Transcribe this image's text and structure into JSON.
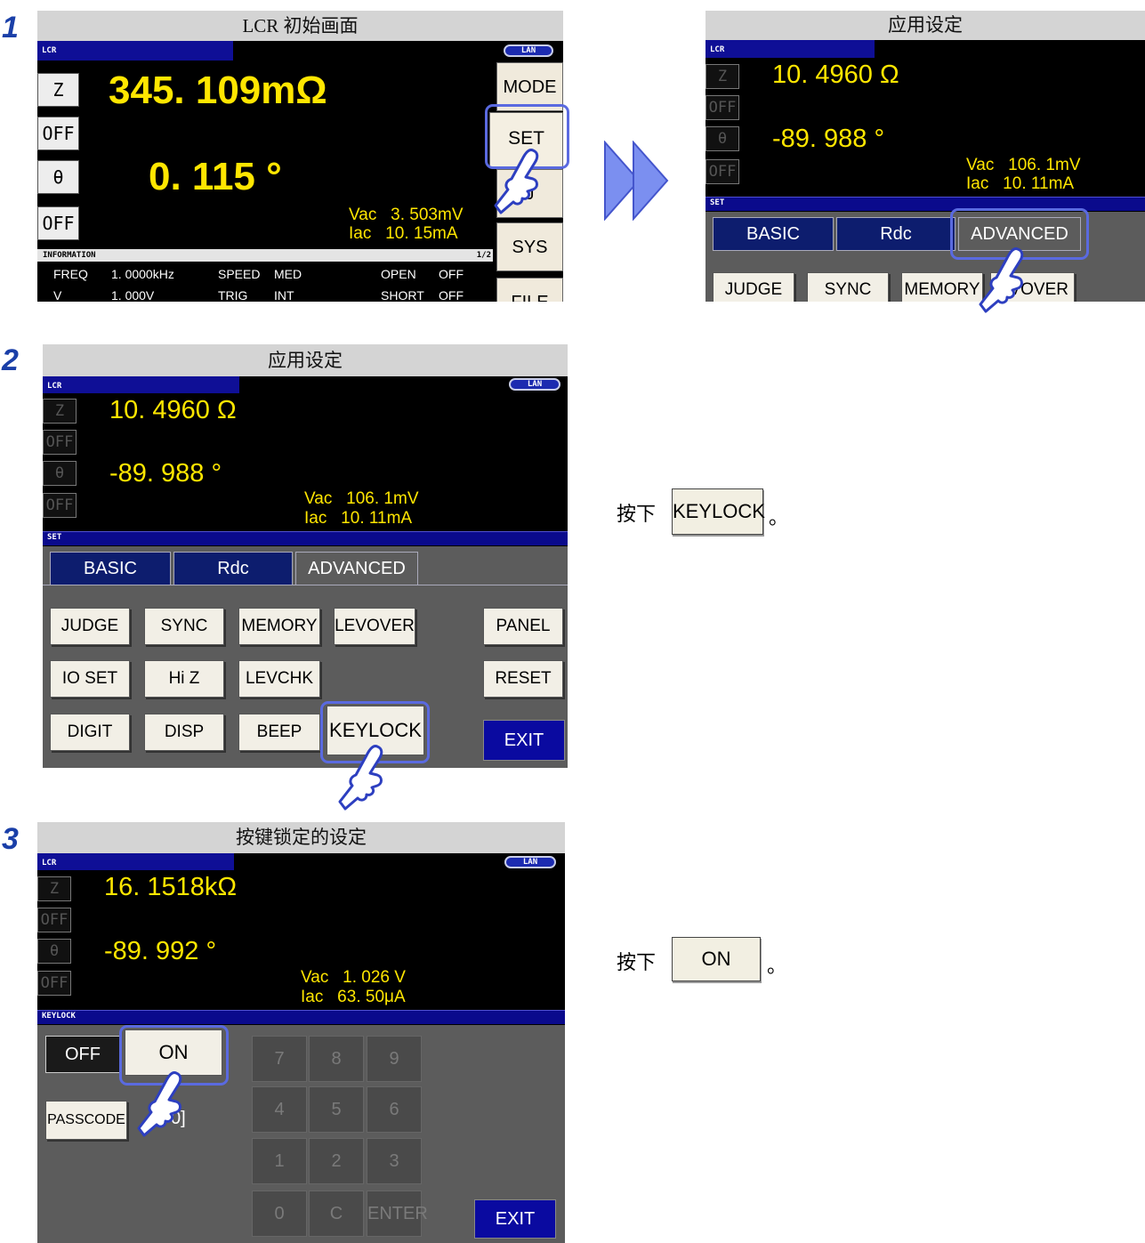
{
  "steps": {
    "s1": "1",
    "s2": "2",
    "s3": "3"
  },
  "p1": {
    "title": "LCR 初始画面",
    "mode_tag": "LCR",
    "lan": "LAN",
    "param1": "Z",
    "value1": "345. 109mΩ",
    "off1": "OFF",
    "param2": "θ",
    "value2": "0. 115  °",
    "off2": "OFF",
    "vac": "Vac   3. 503mV",
    "iac": "Iac   10. 15mA",
    "side": {
      "mode": "MODE",
      "set": "SET",
      "adj": "J",
      "sys": "SYS",
      "file": "FILE"
    },
    "info": {
      "header": "INFORMATION",
      "page": "1/2",
      "row1": [
        "FREQ",
        "1. 0000kHz",
        "SPEED",
        "MED",
        "OPEN",
        "OFF"
      ],
      "row2": [
        "V",
        "1. 000V",
        "TRIG",
        "INT",
        "SHORT",
        "OFF"
      ]
    }
  },
  "p1b": {
    "title": "应用设定",
    "mode_tag": "LCR",
    "param1": "Z",
    "value1": "10. 4960  Ω",
    "off1": "OFF",
    "param2": "θ",
    "value2": "-89. 988  °",
    "off2": "OFF",
    "vac": "Vac   106. 1mV",
    "iac": "Iac   10. 11mA",
    "setbar": "SET",
    "tabs": [
      "BASIC",
      "Rdc",
      "ADVANCED"
    ],
    "buttons": [
      "JUDGE",
      "SYNC",
      "MEMORY",
      "VOVER"
    ]
  },
  "p2": {
    "title": "应用设定",
    "mode_tag": "LCR",
    "lan": "LAN",
    "param1": "Z",
    "value1": "10. 4960  Ω",
    "off1": "OFF",
    "param2": "θ",
    "value2": "-89. 988  °",
    "off2": "OFF",
    "vac": "Vac   106. 1mV",
    "iac": "Iac   10. 11mA",
    "setbar": "SET",
    "tabs": [
      "BASIC",
      "Rdc",
      "ADVANCED"
    ],
    "row1": [
      "JUDGE",
      "SYNC",
      "MEMORY",
      "LEVOVER"
    ],
    "row2": [
      "IO SET",
      "Hi Z",
      "LEVCHK"
    ],
    "row3": [
      "DIGIT",
      "DISP",
      "BEEP",
      "KEYLOCK"
    ],
    "panel": "PANEL",
    "reset": "RESET",
    "exit": "EXIT"
  },
  "p3": {
    "title": "按键锁定的设定",
    "mode_tag": "LCR",
    "lan": "LAN",
    "param1": "Z",
    "value1": "16. 1518kΩ",
    "off1": "OFF",
    "param2": "θ",
    "value2": "-89. 992  °",
    "off2": "OFF",
    "vac": "Vac   1. 026 V",
    "iac": "Iac   63. 50μA",
    "bar": "KEYLOCK",
    "off": "OFF",
    "on": "ON",
    "passcode": "PASSCODE",
    "passval": "0]",
    "keys": [
      "7",
      "8",
      "9",
      "4",
      "5",
      "6",
      "1",
      "2",
      "3",
      "0",
      "C",
      "ENTER"
    ],
    "exit": "EXIT"
  },
  "instr": {
    "press": "按下",
    "keylock": "KEYLOCK",
    "on": "ON",
    "period": "。"
  }
}
